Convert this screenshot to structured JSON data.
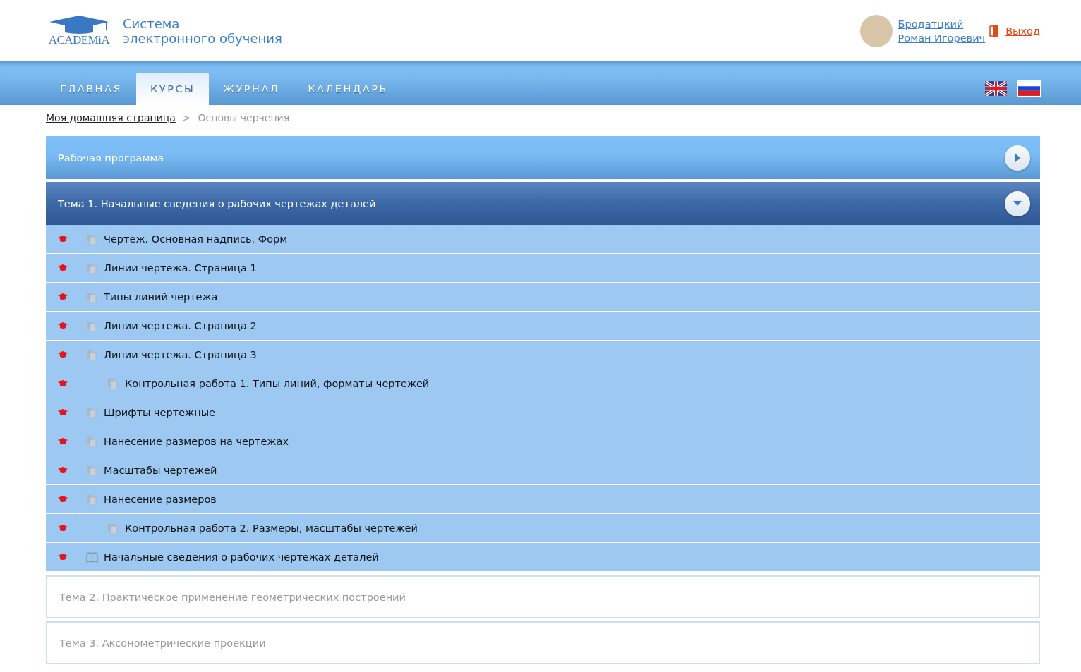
{
  "header": {
    "logo_text": "ACADEMiA",
    "title_line1": "Система",
    "title_line2": "электронного обучения",
    "user_name_line1": "Бродатцкий",
    "user_name_line2": "Роман Игоревич",
    "logout": "Выход"
  },
  "nav": {
    "tabs": [
      {
        "label": "ГЛАВНАЯ",
        "selected": false
      },
      {
        "label": "КУРСЫ",
        "selected": true
      },
      {
        "label": "ЖУРНАЛ",
        "selected": false
      },
      {
        "label": "КАЛЕНДАРЬ",
        "selected": false
      }
    ],
    "languages": [
      {
        "kind": "en",
        "selected": false
      },
      {
        "kind": "ru",
        "selected": true
      }
    ]
  },
  "breadcrumb": {
    "link": "Моя домашняя страница",
    "separator": ">",
    "current": "Основы черчения"
  },
  "sections": [
    {
      "kind": "program",
      "title": "Рабочая программа",
      "expanded": false
    },
    {
      "kind": "topic",
      "title": "Тема 1. Начальные сведения о рабочих чертежах деталей",
      "expanded": true,
      "items": [
        {
          "kind": "page",
          "title": "Чертеж. Основная надпись. Форм"
        },
        {
          "kind": "page",
          "title": "Линии чертежа. Страница 1"
        },
        {
          "kind": "page",
          "title": "Типы линий чертежа"
        },
        {
          "kind": "page",
          "title": "Линии чертежа. Страница 2"
        },
        {
          "kind": "page",
          "title": "Линии чертежа. Страница 3",
          "children": [
            {
              "kind": "page",
              "title": "Контрольная работа 1. Типы линий, форматы чертежей"
            }
          ]
        },
        {
          "kind": "page",
          "title": "Шрифты чертежные"
        },
        {
          "kind": "page",
          "title": "Нанесение размеров на чертежах"
        },
        {
          "kind": "page",
          "title": "Масштабы чертежей"
        },
        {
          "kind": "page",
          "title": "Нанесение размеров",
          "children": [
            {
              "kind": "page",
              "title": "Контрольная работа 2. Размеры, масштабы чертежей"
            }
          ]
        },
        {
          "kind": "book",
          "title": "Начальные сведения о рабочих чертежах деталей"
        }
      ]
    },
    {
      "kind": "topic",
      "title": "Тема 2. Практическое применение геометрических построений",
      "expanded": false
    },
    {
      "kind": "topic",
      "title": "Тема 3. Аксонометрические проекции",
      "expanded": false
    }
  ]
}
